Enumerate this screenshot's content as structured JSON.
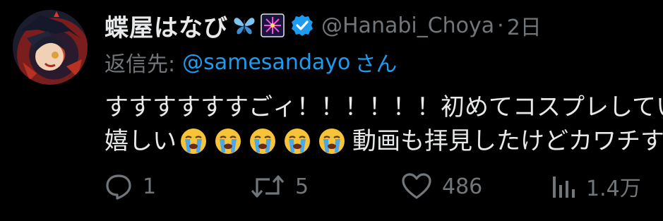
{
  "author": {
    "display_name": "蝶屋はなび",
    "emojis": [
      "butterfly-emoji",
      "fireworks-emoji"
    ],
    "verified": true,
    "handle": "@Hanabi_Choya",
    "separator": "·",
    "time": "2日"
  },
  "reply": {
    "label": "返信先:",
    "handle": "@samesandayo",
    "suffix": "さん"
  },
  "body": {
    "line1": "すすすすすすごィ！！！！！！初めてコスプレしていた",
    "line2_prefix": "嬉しい",
    "emoji": "loudly-crying-face",
    "emoji_count": 5,
    "line2_suffix": "動画も拝見したけどカワチす"
  },
  "actions": {
    "replies": "1",
    "reposts": "5",
    "likes": "486",
    "views": "1.4万"
  },
  "colors": {
    "background": "#000000",
    "text": "#e7e9ea",
    "muted": "#71767b",
    "accent": "#1d9bf0"
  }
}
